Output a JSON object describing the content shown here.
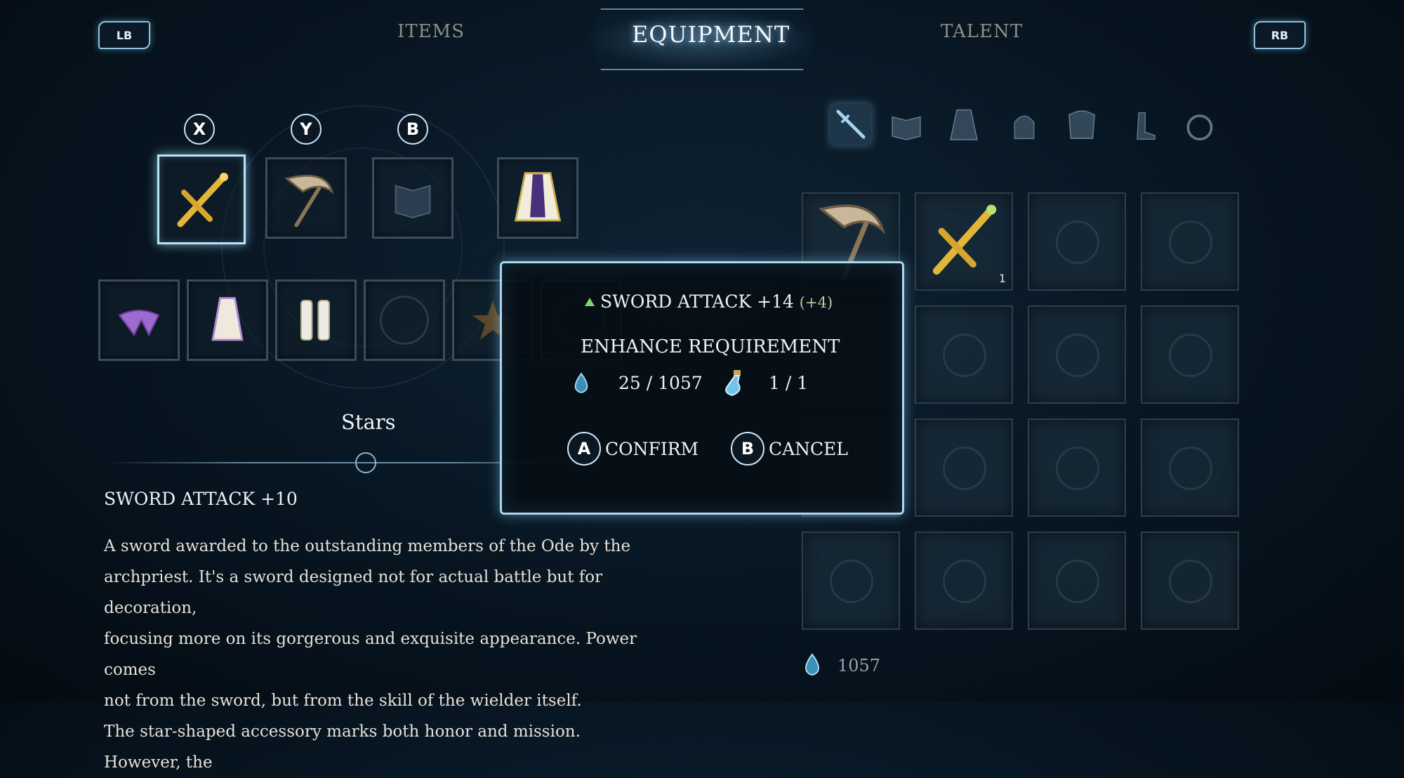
{
  "top_bar": {
    "left_shoulder": "LB",
    "right_shoulder": "RB",
    "tabs": [
      {
        "label": "ITEMS",
        "active": false
      },
      {
        "label": "EQUIPMENT",
        "active": true
      },
      {
        "label": "TALENT",
        "active": false
      }
    ]
  },
  "equip_buttons": {
    "x": "X",
    "y": "Y",
    "b": "B"
  },
  "equipped_slots": {
    "row1": [
      {
        "icon": "golden-sword-icon",
        "selected": true
      },
      {
        "icon": "scythe-icon",
        "selected": false
      },
      {
        "icon": "empty-book-icon",
        "selected": false
      },
      {
        "icon": "purple-cape-icon",
        "selected": false
      }
    ],
    "row2": [
      {
        "icon": "purple-ribbon-icon"
      },
      {
        "icon": "white-robe-icon"
      },
      {
        "icon": "white-boots-icon"
      },
      {
        "icon": "empty-ring-icon"
      },
      {
        "icon": "star-accessory-icon"
      },
      {
        "icon": "empty-slot-icon"
      }
    ]
  },
  "selected_item": {
    "name": "Stars",
    "stat": "SWORD ATTACK +10",
    "description": [
      "A sword awarded to the outstanding members of the Ode by the",
      "archpriest. It's a sword designed not for actual battle but for decoration,",
      "focusing more on its gorgerous and exquisite appearance. Power comes",
      "not from the sword, but from the skill of the wielder itself.",
      "The star-shaped accessory marks both honor and mission. However, the"
    ]
  },
  "categories": [
    {
      "icon": "sword-category-icon",
      "active": true
    },
    {
      "icon": "book-category-icon",
      "active": false
    },
    {
      "icon": "robe-category-icon",
      "active": false
    },
    {
      "icon": "helmet-category-icon",
      "active": false
    },
    {
      "icon": "armor-category-icon",
      "active": false
    },
    {
      "icon": "boots-category-icon",
      "active": false
    },
    {
      "icon": "ring-category-icon",
      "active": false
    }
  ],
  "inventory": {
    "slots": [
      {
        "icon": "scythe-icon",
        "count": ""
      },
      {
        "icon": "golden-sword-icon",
        "count": "1"
      }
    ]
  },
  "modal": {
    "stat_label": "SWORD ATTACK +14",
    "stat_delta": "(+4)",
    "requirement_title": "ENHANCE REQUIREMENT",
    "essence_value": "25 / 1057",
    "potion_value": "1 / 1",
    "confirm_button": "A",
    "confirm_label": "CONFIRM",
    "cancel_button": "B",
    "cancel_label": "CANCEL"
  },
  "currency": {
    "icon": "essence-drop-icon",
    "amount": "1057"
  },
  "colors": {
    "accent": "#a9d7ee",
    "gold": "#e0b43a",
    "stat_green": "#7fd46a"
  }
}
